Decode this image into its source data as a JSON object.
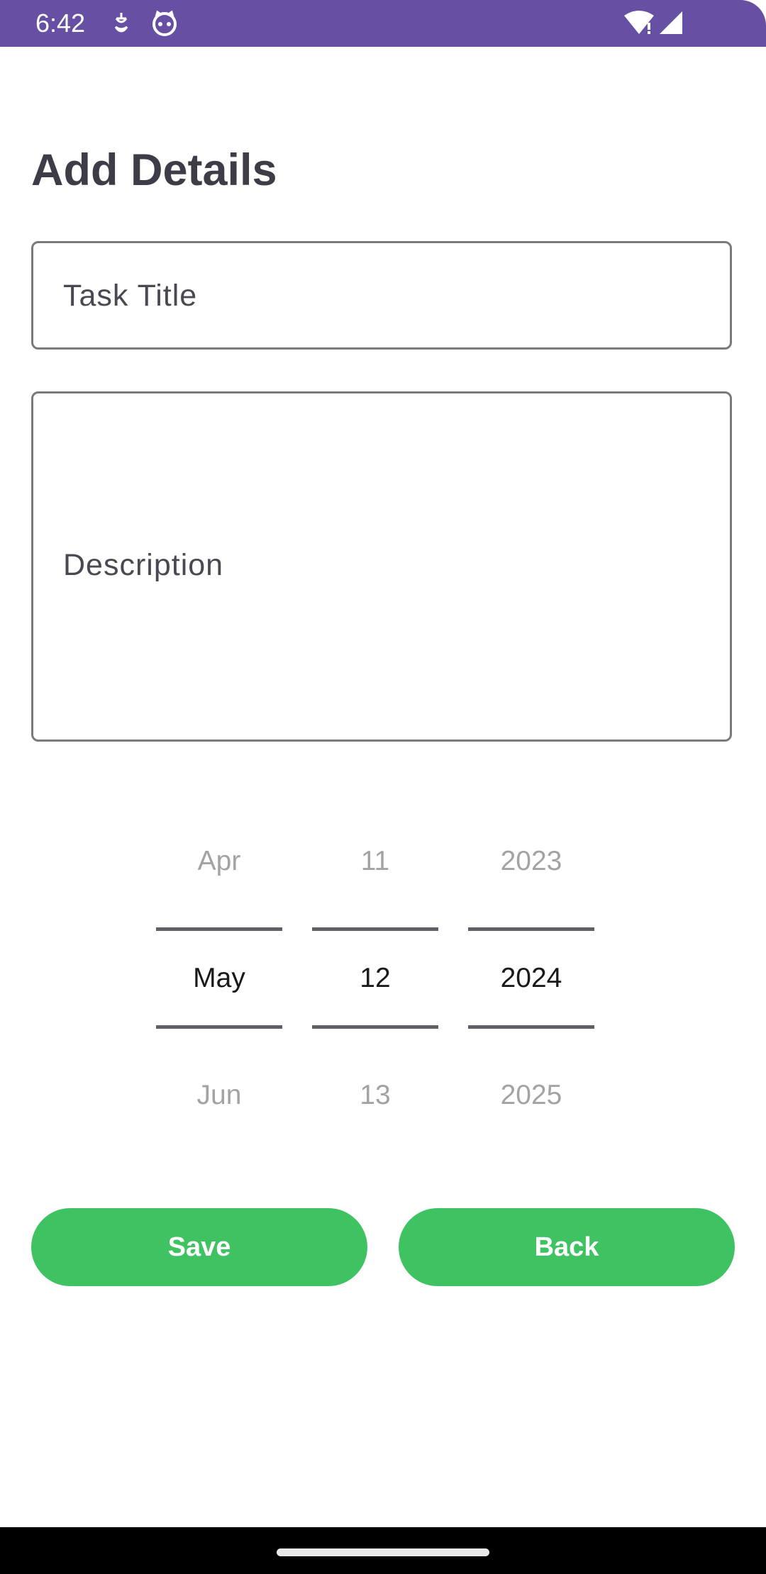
{
  "status_bar": {
    "time": "6:42",
    "icons": [
      "notification-icon",
      "cat-face-icon",
      "wifi-alert-icon",
      "signal-icon"
    ],
    "background": "#6750a4"
  },
  "form": {
    "title": "Add Details",
    "task_title_placeholder": "Task Title",
    "task_title_value": "",
    "description_placeholder": "Description",
    "description_value": ""
  },
  "date_picker": {
    "month": {
      "prev": "Apr",
      "selected": "May",
      "next": "Jun"
    },
    "day": {
      "prev": "11",
      "selected": "12",
      "next": "13"
    },
    "year": {
      "prev": "2023",
      "selected": "2024",
      "next": "2025"
    }
  },
  "buttons": {
    "save_label": "Save",
    "back_label": "Back",
    "color": "#3ec262"
  }
}
